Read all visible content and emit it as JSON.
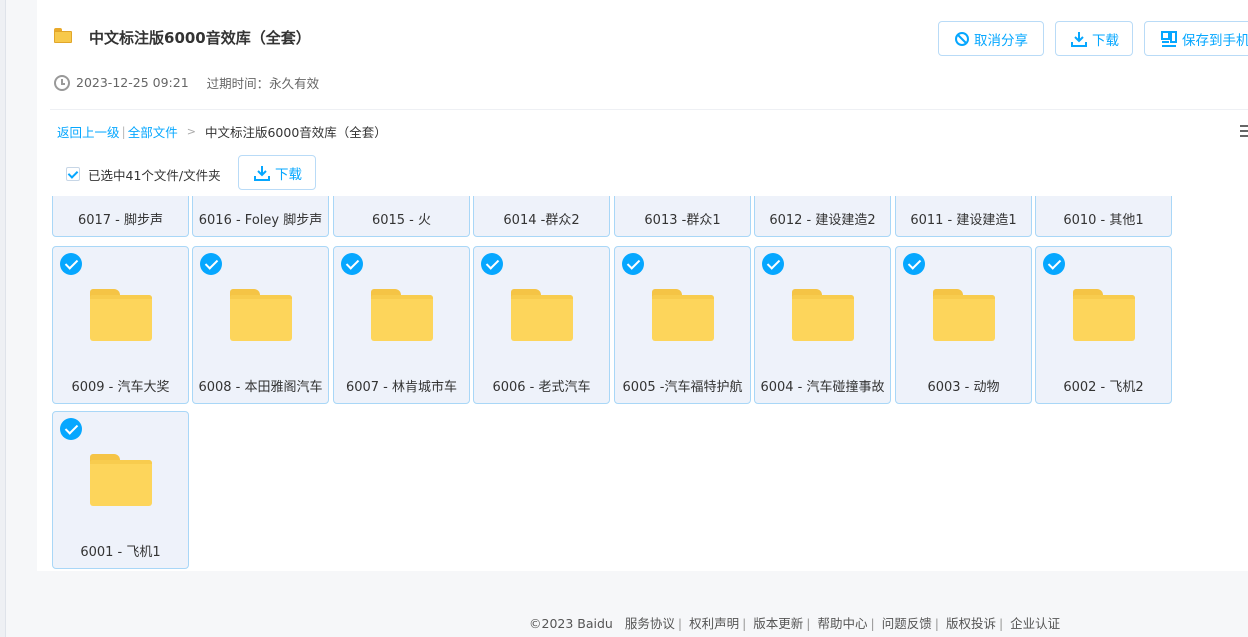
{
  "header": {
    "title": "中文标注版6000音效库（全套）",
    "created": "2023-12-25 09:21",
    "expire_label": "过期时间：",
    "expire_value": "永久有效"
  },
  "actions": {
    "cancel_share": "取消分享",
    "download": "下载",
    "save_to_phone": "保存到手机"
  },
  "breadcrumb": {
    "back": "返回上一级",
    "all_files": "全部文件",
    "current": "中文标注版6000音效库（全套）"
  },
  "selection": {
    "text": "已选中41个文件/文件夹",
    "download": "下载"
  },
  "files": [
    {
      "name": "6017 - 脚步声"
    },
    {
      "name": "6016 - Foley 脚步声"
    },
    {
      "name": "6015 - 火"
    },
    {
      "name": "6014 -群众2"
    },
    {
      "name": "6013 -群众1"
    },
    {
      "name": "6012 - 建设建造2"
    },
    {
      "name": "6011 - 建设建造1"
    },
    {
      "name": "6010 - 其他1"
    },
    {
      "name": "6009 - 汽车大奖"
    },
    {
      "name": "6008 - 本田雅阁汽车"
    },
    {
      "name": "6007 - 林肯城市车"
    },
    {
      "name": "6006 - 老式汽车"
    },
    {
      "name": "6005 -汽车福特护航"
    },
    {
      "name": "6004 - 汽车碰撞事故"
    },
    {
      "name": "6003 - 动物"
    },
    {
      "name": "6002 - 飞机2"
    },
    {
      "name": "6001 - 飞机1"
    }
  ],
  "footer": {
    "copyright": "©2023 Baidu",
    "links": [
      "服务协议",
      "权利声明",
      "版本更新",
      "帮助中心",
      "问题反馈",
      "版权投诉",
      "企业认证"
    ]
  }
}
